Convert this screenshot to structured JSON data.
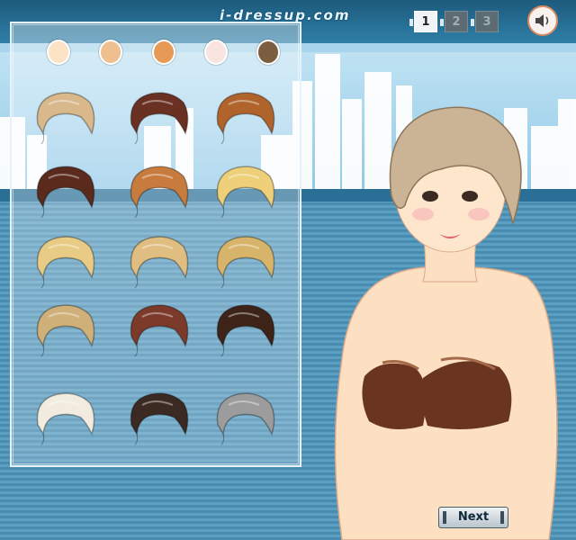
{
  "header": {
    "logo": "i-dressup.com"
  },
  "pages": [
    {
      "label": "1",
      "active": true
    },
    {
      "label": "2",
      "active": false
    },
    {
      "label": "3",
      "active": false
    }
  ],
  "sound_icon": "speaker-icon",
  "skin_tones": [
    "#fde3c6",
    "#f0bf8f",
    "#e69a56",
    "#f9e4e1",
    "#7a5e3f"
  ],
  "hairstyles": [
    {
      "name": "hairstyle-1",
      "color": "#d9b98c"
    },
    {
      "name": "hairstyle-2",
      "color": "#6a3122"
    },
    {
      "name": "hairstyle-3",
      "color": "#b0642c"
    },
    {
      "name": "hairstyle-4",
      "color": "#5a2a1d"
    },
    {
      "name": "hairstyle-5",
      "color": "#c77c3e"
    },
    {
      "name": "hairstyle-6",
      "color": "#efd07a"
    },
    {
      "name": "hairstyle-7",
      "color": "#e8cc86"
    },
    {
      "name": "hairstyle-8",
      "color": "#e0bd80"
    },
    {
      "name": "hairstyle-9",
      "color": "#d8b46a"
    },
    {
      "name": "hairstyle-10",
      "color": "#cfb079"
    },
    {
      "name": "hairstyle-11",
      "color": "#7c3a2a"
    },
    {
      "name": "hairstyle-12",
      "color": "#3e2418"
    },
    {
      "name": "hairstyle-13",
      "color": "#f1ecdf"
    },
    {
      "name": "hairstyle-14",
      "color": "#3b2a22"
    },
    {
      "name": "hairstyle-15",
      "color": "#9c9c9c"
    }
  ],
  "next_button": {
    "label": "Next"
  }
}
